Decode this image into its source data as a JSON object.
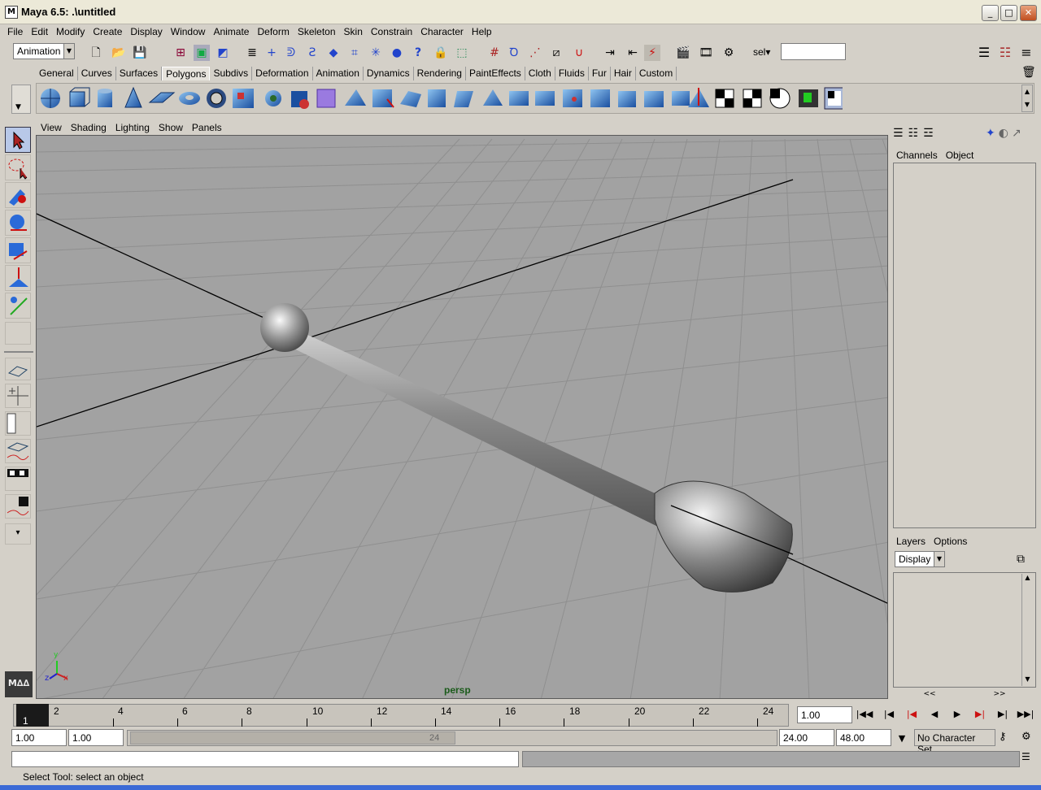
{
  "window": {
    "title": "Maya 6.5: .\\untitled",
    "icon": "M",
    "minimize": "_",
    "maximize": "□",
    "close": "✕"
  },
  "menubar": [
    "File",
    "Edit",
    "Modify",
    "Create",
    "Display",
    "Window",
    "Animate",
    "Deform",
    "Skeleton",
    "Skin",
    "Constrain",
    "Character",
    "Help"
  ],
  "status_line": {
    "menu_set": "Animation",
    "sel_label": "sel▾",
    "sel_value": ""
  },
  "shelf_tabs": [
    "General",
    "Curves",
    "Surfaces",
    "Polygons",
    "Subdivs",
    "Deformation",
    "Animation",
    "Dynamics",
    "Rendering",
    "PaintEffects",
    "Cloth",
    "Fluids",
    "Fur",
    "Hair",
    "Custom"
  ],
  "active_shelf": "Polygons",
  "shelf_icons": [
    "poly-sphere",
    "poly-cube",
    "poly-cylinder",
    "poly-cone",
    "poly-plane",
    "poly-torus",
    "poly-pipe",
    "poly-helix",
    "poly-soccer",
    "poly-sphere-blue",
    "poly-cube-purple",
    "extrude-face",
    "extrude-edge",
    "split-polygon",
    "insert-edge-loop",
    "smooth",
    "bevel",
    "bridge",
    "append",
    "merge",
    "combine",
    "separate",
    "extract",
    "wedge",
    "poke",
    "collapse",
    "mirror",
    "checker-map-1",
    "checker-map-2",
    "checker-map-3",
    "checker-map-4"
  ],
  "viewport_menu": [
    "View",
    "Shading",
    "Lighting",
    "Show",
    "Panels"
  ],
  "viewport": {
    "camera": "persp",
    "axis_y": "y",
    "axis_z": "z",
    "axis_x": "x"
  },
  "channel_box": {
    "tabs": [
      "Channels",
      "Object"
    ]
  },
  "layer_editor": {
    "tabs": [
      "Layers",
      "Options"
    ],
    "mode": "Display"
  },
  "timeline": {
    "current_frame": "1",
    "ticks": [
      "2",
      "4",
      "6",
      "8",
      "10",
      "12",
      "14",
      "16",
      "18",
      "20",
      "22",
      "24"
    ],
    "current_time": "1.00"
  },
  "range": {
    "start_time": "1.00",
    "playback_start": "1.00",
    "slider_end_label": "24",
    "playback_end": "24.00",
    "end_time": "48.00",
    "character_set": "No Character Set"
  },
  "help_line": "Select Tool: select an object"
}
